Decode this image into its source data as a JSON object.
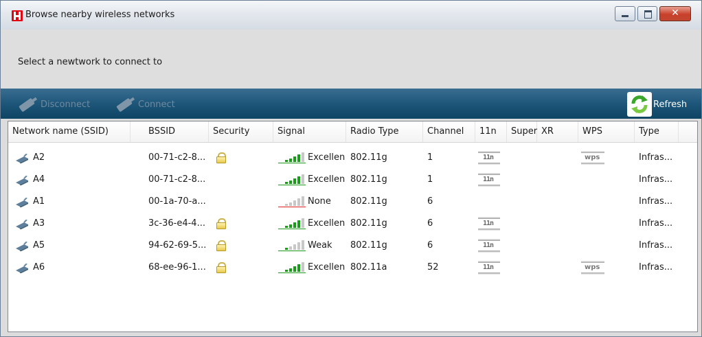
{
  "window": {
    "title": "Browse nearby wireless networks",
    "controls": {
      "minimize_icon": "minimize-icon",
      "maximize_icon": "maximize-icon",
      "close_label": "✕"
    }
  },
  "header": {
    "instruction": "Select a newtwork to connect to"
  },
  "toolbar": {
    "disconnect_label": "Disconnect",
    "connect_label": "Connect",
    "refresh_label": "Refresh",
    "disabled_color": "#6f8aa0",
    "background_color": "#1d5679"
  },
  "table": {
    "columns": [
      "Network name (SSID)",
      "BSSID",
      "Security",
      "Signal",
      "Radio Type",
      "Channel",
      "11n",
      "Super",
      "XR",
      "WPS",
      "Type"
    ],
    "rows": [
      {
        "ssid": "A2",
        "bssid": "00-71-c2-8...",
        "secured": true,
        "signal_level": 4,
        "signal": "Excellen",
        "radio": "802.11g",
        "channel": "1",
        "n11": true,
        "wps": true,
        "wps_label": "wps",
        "type": "Infras..."
      },
      {
        "ssid": "A4",
        "bssid": "00-71-c2-8...",
        "secured": false,
        "signal_level": 4,
        "signal": "Excellen",
        "radio": "802.11g",
        "channel": "1",
        "n11": true,
        "wps": false,
        "wps_label": "",
        "type": "Infras..."
      },
      {
        "ssid": "A1",
        "bssid": "00-1a-70-a...",
        "secured": false,
        "signal_level": 0,
        "signal": "None",
        "radio": "802.11g",
        "channel": "6",
        "n11": false,
        "wps": false,
        "wps_label": "",
        "type": "Infras..."
      },
      {
        "ssid": "A3",
        "bssid": "3c-36-e4-4...",
        "secured": true,
        "signal_level": 4,
        "signal": "Excellen",
        "radio": "802.11g",
        "channel": "6",
        "n11": true,
        "wps": false,
        "wps_label": "",
        "type": "Infras..."
      },
      {
        "ssid": "A5",
        "bssid": "94-62-69-5...",
        "secured": true,
        "signal_level": 1,
        "signal": "Weak",
        "radio": "802.11g",
        "channel": "6",
        "n11": true,
        "wps": false,
        "wps_label": "",
        "type": "Infras..."
      },
      {
        "ssid": "A6",
        "bssid": "68-ee-96-1...",
        "secured": true,
        "signal_level": 4,
        "signal": "Excellen",
        "radio": "802.11a",
        "channel": "52",
        "n11": true,
        "wps": true,
        "wps_label": "wps",
        "type": "Infras..."
      }
    ],
    "n11_label": "11n",
    "colors": {
      "signal_active": "#1a9c1a",
      "signal_inactive": "#c8c8c8",
      "signal_none_base": "#e02020",
      "signal_base": "#1a9c1a"
    }
  },
  "icons": {
    "app": "h-app-icon",
    "network": "router-icon",
    "security": "lock-icon",
    "disconnect": "plug-icon",
    "connect": "plug-icon",
    "refresh": "refresh-arrows-icon"
  }
}
